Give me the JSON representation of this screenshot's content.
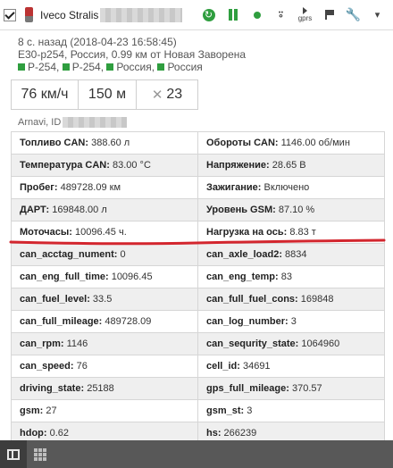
{
  "header": {
    "unit_name": "Iveco Stralis",
    "icons": [
      "checkbox-icon",
      "truck-icon",
      "refresh-icon",
      "pause-icon",
      "status-dot-icon",
      "sensor-icon",
      "gprs-icon",
      "flag-icon",
      "wrench-icon",
      "chevron-down-icon"
    ],
    "gprs_label": "gprs",
    "accent_color": "#2f9e3f"
  },
  "info": {
    "time_line": "8 с. назад (2018-04-23 16:58:45)",
    "location_line": "E30-p254, Россия, 0.99 км от Новая Заворена",
    "roads": [
      "P-254,",
      "P-254,",
      "Россия,",
      "Россия"
    ]
  },
  "stats": {
    "speed": "76 км/ч",
    "altitude": "150 м",
    "satellites": "23"
  },
  "device": {
    "label": "Arnavi, ID"
  },
  "params": [
    [
      {
        "k": "Топливо CAN:",
        "v": " 388.60 л",
        "bold": true
      },
      {
        "k": "Обороты CAN:",
        "v": " 1146.00 об/мин",
        "bold": true
      }
    ],
    [
      {
        "k": "Температура CAN:",
        "v": " 83.00 °C",
        "bold": true
      },
      {
        "k": "Напряжение:",
        "v": " 28.65 В",
        "bold": true
      }
    ],
    [
      {
        "k": "Пробег:",
        "v": " 489728.09 км",
        "bold": true
      },
      {
        "k": "Зажигание:",
        "v": " Включено",
        "bold": true
      }
    ],
    [
      {
        "k": "ДАРТ:",
        "v": " 169848.00 л",
        "bold": true
      },
      {
        "k": "Уровень GSM:",
        "v": " 87.10 %",
        "bold": true
      }
    ],
    [
      {
        "k": "Моточасы:",
        "v": " 10096.45 ч.",
        "bold": true
      },
      {
        "k": "Нагрузка на ось:",
        "v": " 8.83 т",
        "bold": true
      }
    ],
    [
      {
        "k": "can_acctag_nument:",
        "v": " 0",
        "bold": true
      },
      {
        "k": "can_axle_load2:",
        "v": " 8834",
        "bold": true
      }
    ],
    [
      {
        "k": "can_eng_full_time:",
        "v": " 10096.45",
        "bold": true
      },
      {
        "k": "can_eng_temp:",
        "v": " 83",
        "bold": true
      }
    ],
    [
      {
        "k": "can_fuel_level:",
        "v": " 33.5",
        "bold": true
      },
      {
        "k": "can_full_fuel_cons:",
        "v": " 169848",
        "bold": true
      }
    ],
    [
      {
        "k": "can_full_mileage:",
        "v": " 489728.09",
        "bold": true
      },
      {
        "k": "can_log_number:",
        "v": " 3",
        "bold": true
      }
    ],
    [
      {
        "k": "can_rpm:",
        "v": " 1146",
        "bold": true
      },
      {
        "k": "can_sequrity_state:",
        "v": " 1064960",
        "bold": true
      }
    ],
    [
      {
        "k": "can_speed:",
        "v": " 76",
        "bold": true
      },
      {
        "k": "cell_id:",
        "v": " 34691",
        "bold": true
      }
    ],
    [
      {
        "k": "driving_state:",
        "v": " 25188",
        "bold": true
      },
      {
        "k": "gps_full_mileage:",
        "v": " 370.57",
        "bold": true
      }
    ],
    [
      {
        "k": "gsm:",
        "v": " 27",
        "bold": true
      },
      {
        "k": "gsm_st:",
        "v": " 3",
        "bold": true
      }
    ],
    [
      {
        "k": "hdop:",
        "v": " 0.62",
        "bold": true
      },
      {
        "k": "hs:",
        "v": " 266239",
        "bold": true
      }
    ]
  ],
  "footer": {
    "tabs": [
      "panel-icon",
      "grid-icon"
    ]
  }
}
